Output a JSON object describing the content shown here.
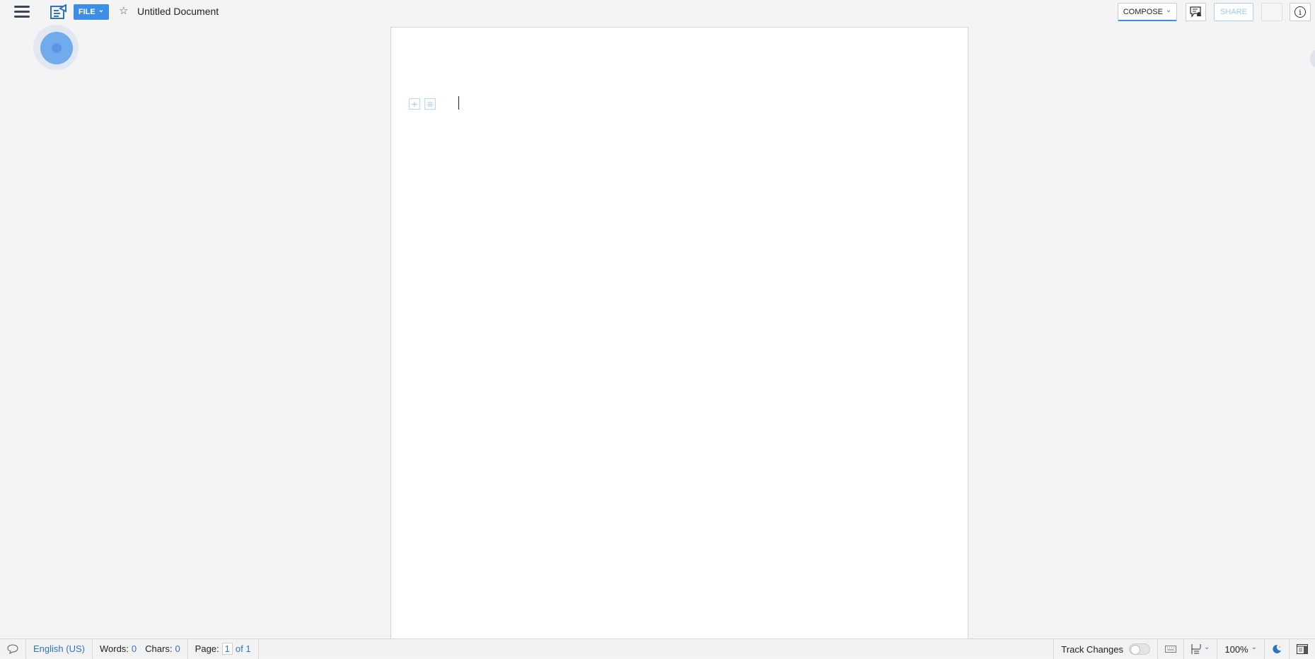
{
  "header": {
    "file_label": "FILE",
    "document_title": "Untitled Document",
    "compose_label": "COMPOSE",
    "share_label": "SHARE",
    "info_glyph": "i"
  },
  "icons": {
    "menu": "hamburger-icon",
    "doc": "document-icon",
    "star": "☆",
    "chevron": "⌄",
    "notify": "comment-bell-icon",
    "add_block": "+",
    "block_format": "≡"
  },
  "editor": {
    "content": ""
  },
  "status": {
    "language": "English (US)",
    "words_label": "Words:",
    "words_value": "0",
    "chars_label": "Chars:",
    "chars_value": "0",
    "page_label": "Page:",
    "page_current": "1",
    "page_total": "of 1",
    "track_changes_label": "Track Changes",
    "track_changes_on": false,
    "zoom": "100%"
  },
  "colors": {
    "accent": "#3d8ee8",
    "link": "#2f72c4",
    "background": "#f4f4f4"
  }
}
